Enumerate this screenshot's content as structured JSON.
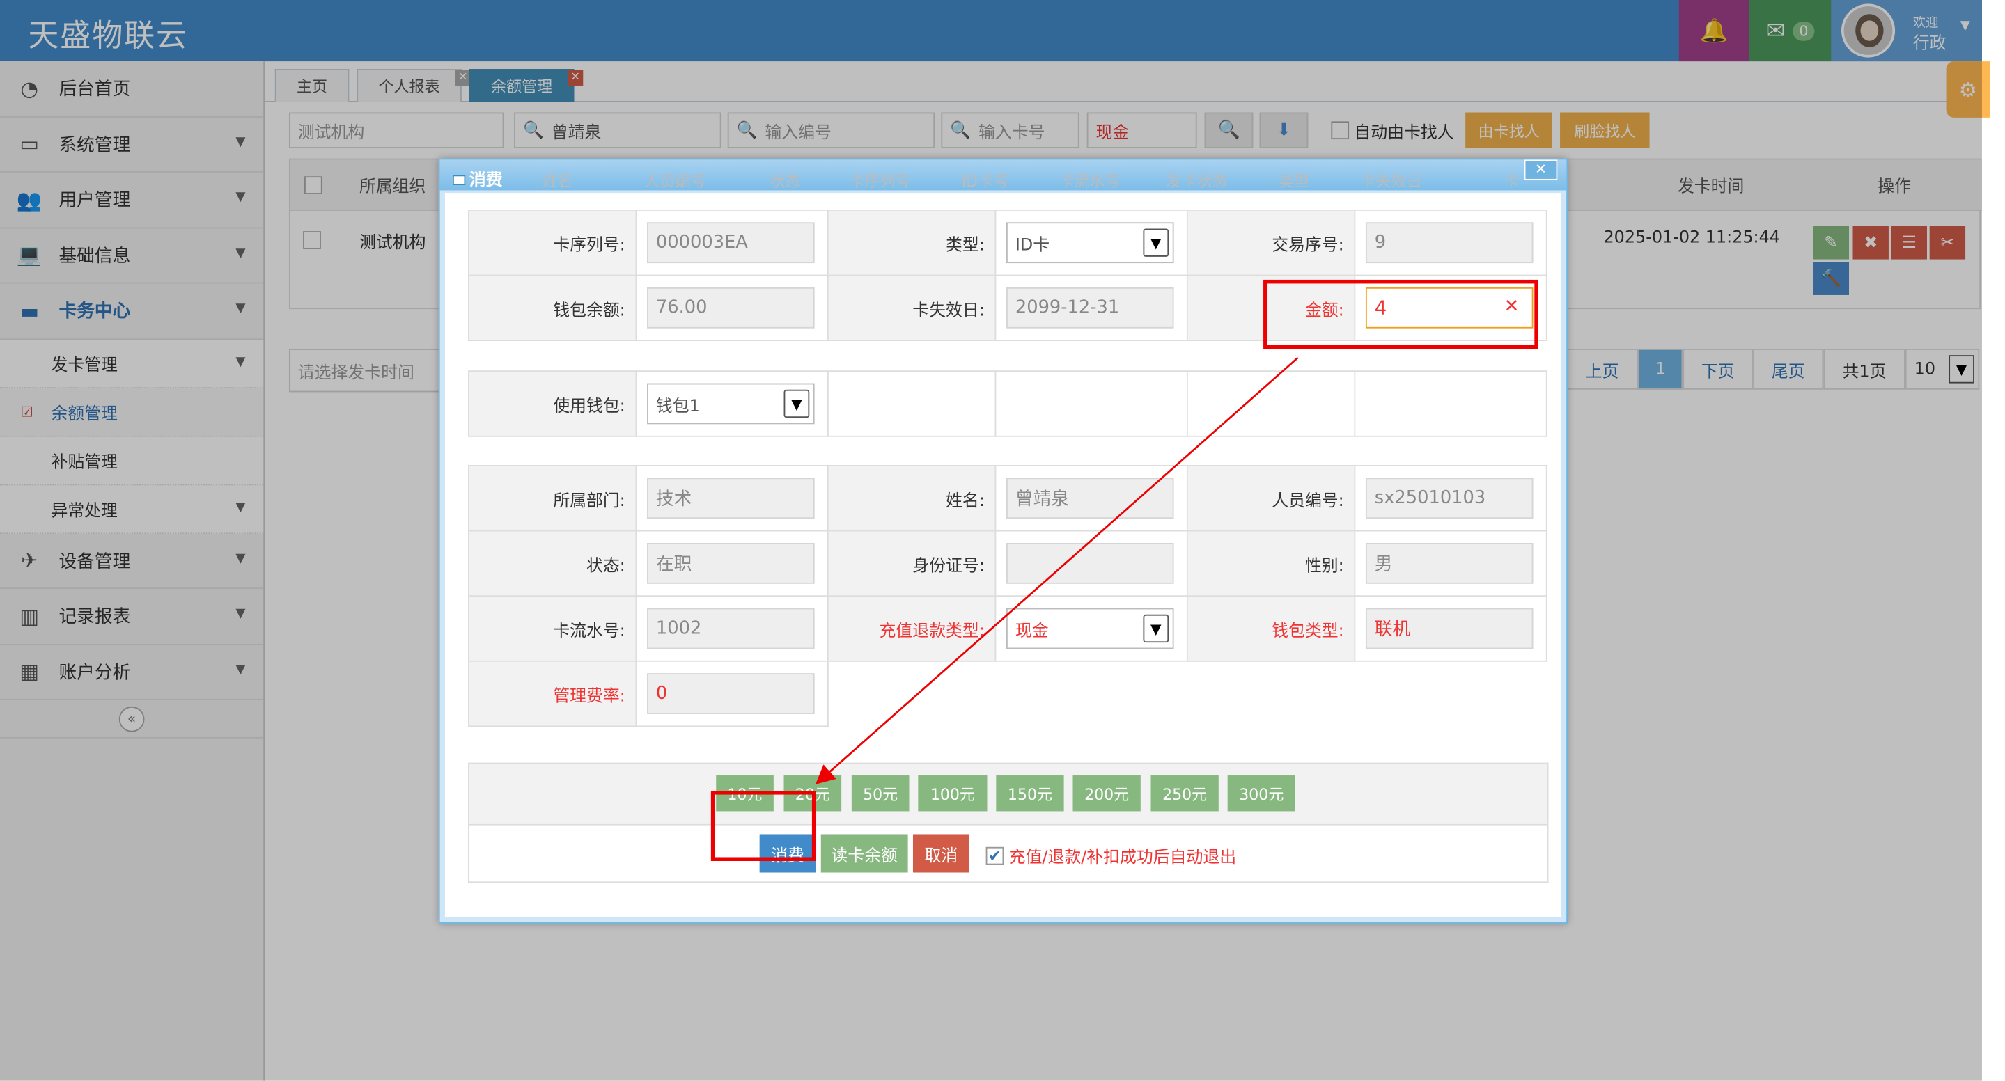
{
  "header": {
    "brand": "天盛物联云",
    "mail_count": "0",
    "welcome": "欢迎",
    "user": "行政"
  },
  "sidebar": {
    "items": [
      {
        "icon": "dashboard-icon",
        "label": "后台首页"
      },
      {
        "icon": "desktop-icon",
        "label": "系统管理"
      },
      {
        "icon": "users-icon",
        "label": "用户管理"
      },
      {
        "icon": "laptop-icon",
        "label": "基础信息"
      },
      {
        "icon": "card-icon",
        "label": "卡务中心"
      }
    ],
    "subitems": [
      {
        "label": "发卡管理"
      },
      {
        "label": "余额管理"
      },
      {
        "label": "补贴管理"
      },
      {
        "label": "异常处理"
      }
    ],
    "items2": [
      {
        "icon": "plane-icon",
        "label": "设备管理"
      },
      {
        "icon": "bar-chart-icon",
        "label": "记录报表"
      },
      {
        "icon": "calendar-icon",
        "label": "账户分析"
      }
    ]
  },
  "tabs": [
    {
      "label": "主页"
    },
    {
      "label": "个人报表"
    },
    {
      "label": "余额管理"
    }
  ],
  "filters": {
    "org": "测试机构",
    "name": "曾靖泉",
    "number_placeholder": "输入编号",
    "card_placeholder": "输入卡号",
    "pay_type": "现金",
    "auto_find": "自动由卡找人",
    "find_by_card": "由卡找人",
    "find_by_face": "刷脸找人",
    "date_placeholder": "请选择发卡时间"
  },
  "table": {
    "headers": [
      "所属组织",
      "姓名",
      "人员编号",
      "状态",
      "卡序列号",
      "ID卡号",
      "卡流水号",
      "发卡状态",
      "类型",
      "卡失效日",
      "卡",
      "发卡时间",
      "操作"
    ],
    "row": {
      "org": "测试机构",
      "issue_time": "2025-01-02 11:25:44"
    }
  },
  "pager": {
    "prev": "上页",
    "page": "1",
    "next": "下页",
    "last": "尾页",
    "total": "共1页",
    "size": "10"
  },
  "modal": {
    "title": "消费",
    "card_serial_label": "卡序列号:",
    "card_serial": "000003EA",
    "type_label": "类型:",
    "type": "ID卡",
    "txn_label": "交易序号:",
    "txn": "9",
    "wallet_balance_label": "钱包余额:",
    "wallet_balance": "76.00",
    "expiry_label": "卡失效日:",
    "expiry": "2099-12-31",
    "amount_label": "金额:",
    "amount": "4",
    "use_wallet_label": "使用钱包:",
    "use_wallet": "钱包1",
    "dept_label": "所属部门:",
    "dept": "技术",
    "name_label": "姓名:",
    "name": "曾靖泉",
    "emp_no_label": "人员编号:",
    "emp_no": "sx25010103",
    "status_label": "状态:",
    "status": "在职",
    "id_label": "身份证号:",
    "id_no": "",
    "gender_label": "性别:",
    "gender": "男",
    "card_flow_label": "卡流水号:",
    "card_flow": "1002",
    "refund_type_label": "充值退款类型:",
    "refund_type": "现金",
    "wallet_type_label": "钱包类型:",
    "wallet_type": "联机",
    "fee_rate_label": "管理费率:",
    "fee_rate": "0",
    "quick": [
      "10元",
      "20元",
      "50元",
      "100元",
      "150元",
      "200元",
      "250元",
      "300元"
    ],
    "consume_btn": "消费",
    "read_btn": "读卡余额",
    "cancel_btn": "取消",
    "auto_exit": "充值/退款/补扣成功后自动退出"
  },
  "colors": {
    "topbar": "#428bca",
    "annotation": "#ee0000"
  }
}
